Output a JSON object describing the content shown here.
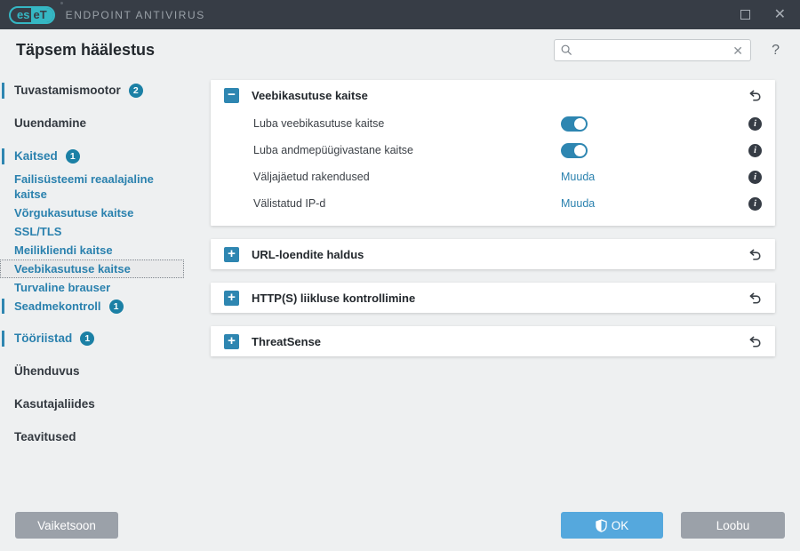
{
  "titlebar": {
    "logo_left": "es",
    "logo_right": "eT",
    "app_title": "ENDPOINT ANTIVIRUS"
  },
  "header": {
    "title": "Täpsem häälestus",
    "search_value": "",
    "search_placeholder": ""
  },
  "icons": {
    "close": "✕",
    "clear": "✕",
    "help": "?",
    "expand": "+",
    "collapse": "−",
    "info": "i"
  },
  "sidebar": {
    "items": [
      {
        "key": "tuvastamismootor",
        "label": "Tuvastamismootor",
        "level": "top",
        "blue": false,
        "badge": "2",
        "bar": true
      },
      {
        "key": "uuendamine",
        "label": "Uuendamine",
        "level": "top",
        "blue": false
      },
      {
        "key": "kaitsed",
        "label": "Kaitsed",
        "level": "top",
        "blue": true,
        "badge": "1",
        "bar": true,
        "tight": true
      },
      {
        "key": "failisusteemi-reaalajaline-kaitse",
        "label": "Failisüsteemi reaalajaline kaitse",
        "level": "sub",
        "blue": true
      },
      {
        "key": "vorgukasutuse-kaitse",
        "label": "Võrgukasutuse kaitse",
        "level": "sub",
        "blue": true
      },
      {
        "key": "ssl-tls",
        "label": "SSL/TLS",
        "level": "sub",
        "blue": true
      },
      {
        "key": "meilikliendi-kaitse",
        "label": "Meilikliendi kaitse",
        "level": "sub",
        "blue": true
      },
      {
        "key": "veebikasutuse-kaitse",
        "label": "Veebikasutuse kaitse",
        "level": "sub",
        "blue": true,
        "selected": true
      },
      {
        "key": "turvaline-brauser",
        "label": "Turvaline brauser",
        "level": "sub",
        "blue": true
      },
      {
        "key": "seadmekontroll",
        "label": "Seadmekontroll",
        "level": "sub",
        "blue": true,
        "badge": "1",
        "bar": true
      },
      {
        "key": "tooriistad",
        "label": "Tööriistad",
        "level": "top",
        "blue": true,
        "badge": "1",
        "bar": true
      },
      {
        "key": "uhenduvus",
        "label": "Ühenduvus",
        "level": "top",
        "blue": false
      },
      {
        "key": "kasutajaliides",
        "label": "Kasutajaliides",
        "level": "top",
        "blue": false
      },
      {
        "key": "teavitused",
        "label": "Teavitused",
        "level": "top",
        "blue": false
      }
    ]
  },
  "main": {
    "sections": [
      {
        "key": "veebikasutuse-kaitse",
        "title": "Veebikasutuse kaitse",
        "expanded": true,
        "rows": [
          {
            "key": "luba-veebikasutuse-kaitse",
            "label": "Luba veebikasutuse kaitse",
            "control": "toggle",
            "on": true
          },
          {
            "key": "luba-andmepuugivastane-kaitse",
            "label": "Luba andmepüügivastane kaitse",
            "control": "toggle",
            "on": true
          },
          {
            "key": "valjajaetud-rakendused",
            "label": "Väljajäetud rakendused",
            "control": "link",
            "action": "Muuda"
          },
          {
            "key": "valistatud-ip-d",
            "label": "Välistatud IP-d",
            "control": "link",
            "action": "Muuda"
          }
        ]
      },
      {
        "key": "url-loendite-haldus",
        "title": "URL-loendite haldus",
        "expanded": false
      },
      {
        "key": "https-liikluse-kontrollimine",
        "title": "HTTP(S) liikluse kontrollimine",
        "expanded": false
      },
      {
        "key": "threatsense",
        "title": "ThreatSense",
        "expanded": false
      }
    ]
  },
  "footer": {
    "defaults_label": "Vaiketsoon",
    "ok_label": "OK",
    "cancel_label": "Loobu"
  },
  "colors": {
    "titlebar_bg": "#373d46",
    "logo_cyan": "#35b7c4",
    "accent_blue": "#2e86b1",
    "link_blue": "#2a81ae",
    "badge_blue": "#1b80a5",
    "ok_button": "#55a8dd",
    "gray_button": "#9ba1a9",
    "page_bg": "#eef0f1"
  }
}
